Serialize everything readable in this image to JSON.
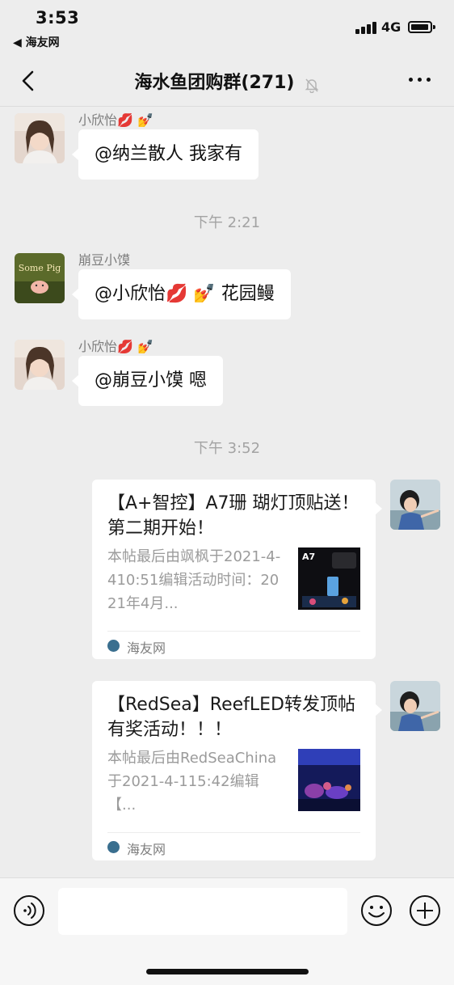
{
  "status_bar": {
    "time": "3:53",
    "back_app": "◀ 海友网",
    "network": "4G"
  },
  "nav": {
    "title": "海水鱼团购群(271)",
    "back_icon": "chevron-left-icon",
    "mute_icon": "bell-slash-icon",
    "more_icon": "ellipsis-icon"
  },
  "messages": [
    {
      "sender": "小欣怡💋 💅",
      "text": "@纳兰散人 我家有"
    },
    {
      "timestamp": "下午 2:21"
    },
    {
      "sender": "崩豆小馍",
      "text": "@小欣怡💋 💅 花园鳗",
      "avatar_text": "Some Pig"
    },
    {
      "sender": "小欣怡💋 💅",
      "text": "@崩豆小馍 嗯"
    },
    {
      "timestamp": "下午 3:52"
    }
  ],
  "cards": [
    {
      "title": "【A+智控】A7珊 瑚灯顶贴送！第二期开始！",
      "description": "本帖最后由飒枫于2021-4-410:51编辑活动时间：2021年4月...",
      "thumb_label": "A7",
      "source": "海友网"
    },
    {
      "title": "【RedSea】ReefLED转发顶帖有奖活动！！！",
      "description": "本帖最后由RedSeaChina于2021-4-115:42编辑【...",
      "source": "海友网"
    }
  ],
  "input_bar": {
    "voice_icon": "voice-icon",
    "emoji_icon": "emoji-icon",
    "plus_icon": "plus-icon",
    "input_value": ""
  },
  "colors": {
    "background": "#ededed",
    "bubble": "#ffffff",
    "meta_text": "#a3a3a3"
  }
}
